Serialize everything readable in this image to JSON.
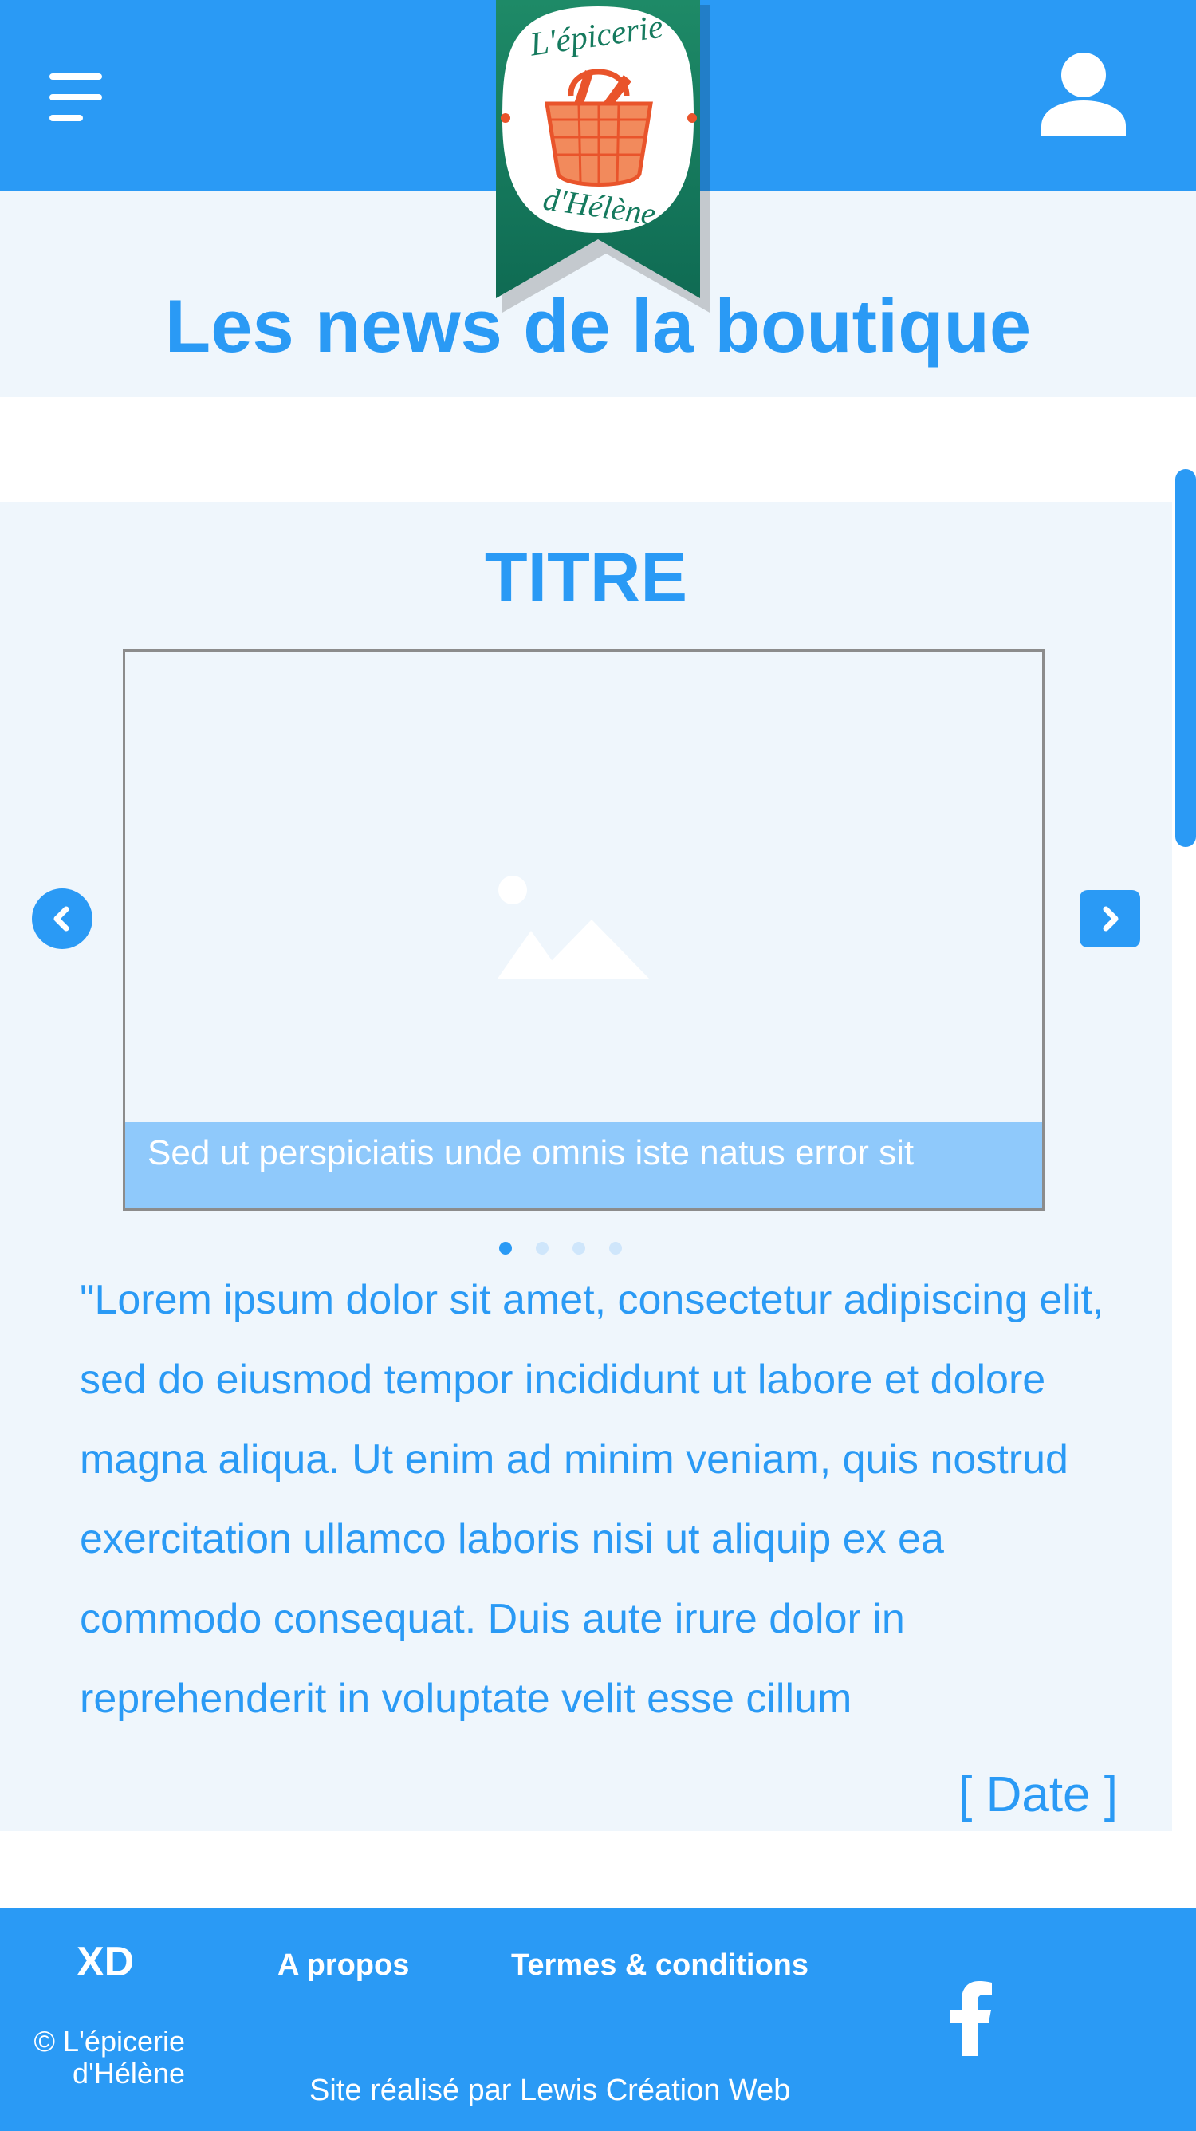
{
  "header": {
    "menu_icon": "hamburger-menu-icon",
    "user_icon": "user-account-icon",
    "logo": {
      "line1": "L'épicerie",
      "line2": "d'Hélène",
      "icon": "basket-icon"
    }
  },
  "page": {
    "title": "Les news de la boutique"
  },
  "news": {
    "title": "TITRE",
    "caption": "Sed ut perspiciatis unde omnis iste natus error sit",
    "text": "\"Lorem ipsum dolor sit amet, consectetur adipiscing elit, sed do eiusmod tempor incididunt ut labore et dolore magna aliqua. Ut enim ad minim veniam, quis nostrud exercitation ullamco laboris nisi ut aliquip ex ea commodo consequat. Duis aute irure dolor in reprehenderit in voluptate velit esse cillum",
    "date": "[ Date ]",
    "carousel": {
      "slides": 4,
      "active": 1
    }
  },
  "footer": {
    "brand": "XD",
    "links": [
      "A propos",
      "Termes & conditions"
    ],
    "copyright_line1": "© L'épicerie",
    "copyright_line2": "d'Hélène",
    "credit": "Site réalisé par Lewis Création Web",
    "social_icon": "facebook-icon"
  },
  "colors": {
    "primary": "#2a9af5",
    "band": "#eff6fc",
    "caption": "#8fc9fb",
    "logo_green": "#157a5e",
    "basket_orange": "#e9542b"
  }
}
